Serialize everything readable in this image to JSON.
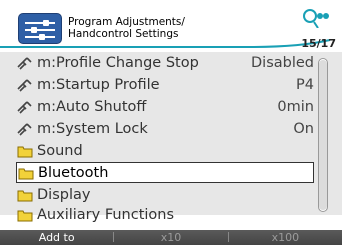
{
  "header": {
    "title_line1": "Program Adjustments/",
    "title_line2": "Handcontrol Settings",
    "page_indicator": "15/17"
  },
  "items": [
    {
      "label": "m:Profile Change Stop",
      "value": "Disabled",
      "icon": "adjust-icon"
    },
    {
      "label": "m:Startup Profile",
      "value": "P4",
      "icon": "adjust-icon"
    },
    {
      "label": "m:Auto Shutoff",
      "value": "0min",
      "icon": "adjust-icon"
    },
    {
      "label": "m:System Lock",
      "value": "On",
      "icon": "adjust-icon"
    },
    {
      "label": "Sound",
      "value": "",
      "icon": "folder-icon"
    },
    {
      "label": "Bluetooth",
      "value": "",
      "icon": "folder-icon"
    },
    {
      "label": "Display",
      "value": "",
      "icon": "folder-icon"
    },
    {
      "label": "Auxiliary Functions",
      "value": "",
      "icon": "folder-icon"
    }
  ],
  "selected_item": "Bluetooth",
  "footer": {
    "btn1": "Add to",
    "btn2": "x10",
    "btn3": "x100"
  },
  "colors": {
    "accent": "#19a0b5",
    "header_icon": "#2e5fa6",
    "folder": "#f2d23a"
  }
}
